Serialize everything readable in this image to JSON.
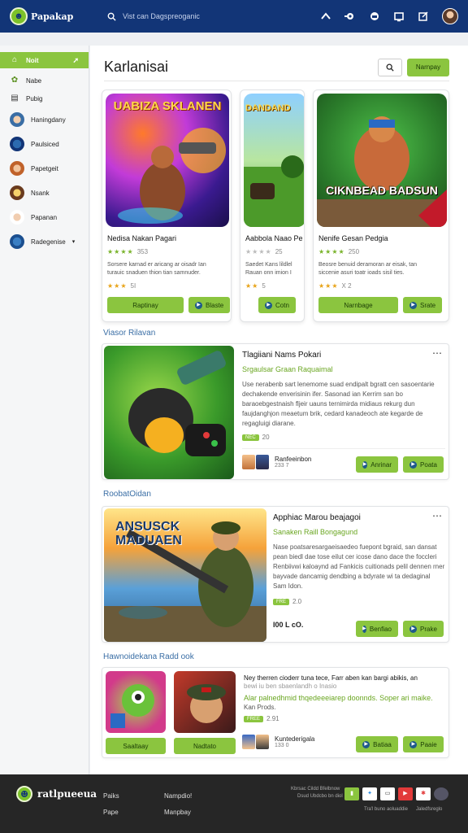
{
  "header": {
    "logo_text": "Papakap",
    "search_placeholder": "Vist can Dagspreoganic",
    "icons": [
      "gamepad-icon",
      "controller-icon",
      "headset-icon",
      "screen-icon",
      "edit-icon",
      "user-avatar"
    ]
  },
  "sidebar": {
    "items": [
      {
        "label": "Noit",
        "icon": "home-icon"
      },
      {
        "label": "Nabe",
        "icon": "plant-icon"
      },
      {
        "label": "Pubig",
        "icon": "doc-icon"
      },
      {
        "label": "Haningdany",
        "icon": "avatar"
      },
      {
        "label": "Paulsiced",
        "icon": "avatar"
      },
      {
        "label": "Papetgeit",
        "icon": "avatar"
      },
      {
        "label": "Nsank",
        "icon": "avatar"
      },
      {
        "label": "Papanan",
        "icon": "avatar"
      },
      {
        "label": "Radegenise",
        "icon": "avatar"
      }
    ]
  },
  "main": {
    "title": "Karlanisai",
    "primary_button": "Narnpay",
    "featured": [
      {
        "art_title": "UABIZA SKLANEN",
        "name": "Nedisa Nakan Pagari",
        "rating_top": "353",
        "desc_lines": [
          "Sorsere karnad er aricang ar oisadr Ian",
          "turauic snaduen thion tian samnuder."
        ],
        "rating_bottom": "5I",
        "btn_main": "Raptinay",
        "btn_sec": "Blaste"
      },
      {
        "art_title": "DANDAND",
        "name": "Aabbola Naao Pe",
        "rating_top": "25",
        "desc_lines": [
          "Saedet Kans lildlel",
          "Rauan onn imion I"
        ],
        "rating_bottom": "5",
        "btn_main": "",
        "btn_sec": "Cotn"
      },
      {
        "art_title": "CIKNBEAD BADSUN",
        "name": "Nenife Gesan Pedgia",
        "rating_top": "250",
        "desc_lines": [
          "Beosre benuid deramoran ar eisak, tan",
          "siccenie asuri toatr ioads sisil ties."
        ],
        "rating_bottom": "X 2",
        "btn_main": "Narnbage",
        "btn_sec": "Srate"
      }
    ],
    "sections": [
      {
        "label": "Viasor Rilavan",
        "title": "Tlagiiani Nams Pokari",
        "subtitle": "Srgaulsar Graan Raquaimal",
        "desc": "Use nerabenb sart lenemome suad endipalt bgratt cen sasoentarie dechakende enverisinin ifer. Sasonad ian Kerrim san bo baraoebgestnaish fljeir uauns ternimirda midiaus rekurg dun faujdanghjon meaetum brik, cedard kanadeoch ate kegarde de regagluigi diarane.",
        "badge": "NEC",
        "rating": "20",
        "dev_name": "Ranfeeinbon",
        "dev_num": "233 7",
        "btn_1": "Anrinar",
        "btn_2": "Poata"
      },
      {
        "label": "RoobatOidan",
        "art_title": "ANSUSCK MADUAEN",
        "title": "Apphiac Marou beajagoi",
        "subtitle": "Sanaken Raill Bongagund",
        "desc": "Nase poatsaresargaeisaedeo fuepont bgraid, san dansat pean biedl dae tose eilut cer icose dano dace the foccleri Renbiivwi kaloaynd ad Fankicis cuitionads pelil dennen rner bayvade dancamig dendbing a bdyrate wi ta dedaginal Sam Idon.",
        "badge": "FRE",
        "rating": "2.0",
        "dev_name": "I00 L cO.",
        "btn_1": "Benfiao",
        "btn_2": "Prake"
      },
      {
        "label": "Hawnoidekana Radd ook",
        "title": "Ney therren cioderr tuna tece, Farr aben kan bargi abikis, an",
        "title2": "bewi iu ben sbaenlandh o Inasio",
        "subtitle": "Alar palnedhmid thqedeeeiarep doonnds. Soper ari maike.",
        "subtitle2": "Kan Prods.",
        "badge": "FREE",
        "rating": "2.91",
        "dev_name": "Kuntederigala",
        "dev_num": "133 0",
        "btn_a": "Saaltaay",
        "btn_b": "Nadtato",
        "btn_1": "Batiaa",
        "btn_2": "Paaie"
      }
    ]
  },
  "footer": {
    "logo_text": "ratlpueeua",
    "col1": [
      "Paiks",
      "Pape"
    ],
    "col2": [
      "Nampdio!",
      "Manpbay"
    ],
    "small_1": "Kbrsac Cildd Bfelbnow",
    "small_2": "Dsud Ubdcbo bn diol",
    "small_3": "Tra'l buno aoluaddie",
    "small_4": "Jaledfsreglo",
    "colors": {
      "accent": "#8bc53f",
      "navy": "#123577"
    }
  }
}
